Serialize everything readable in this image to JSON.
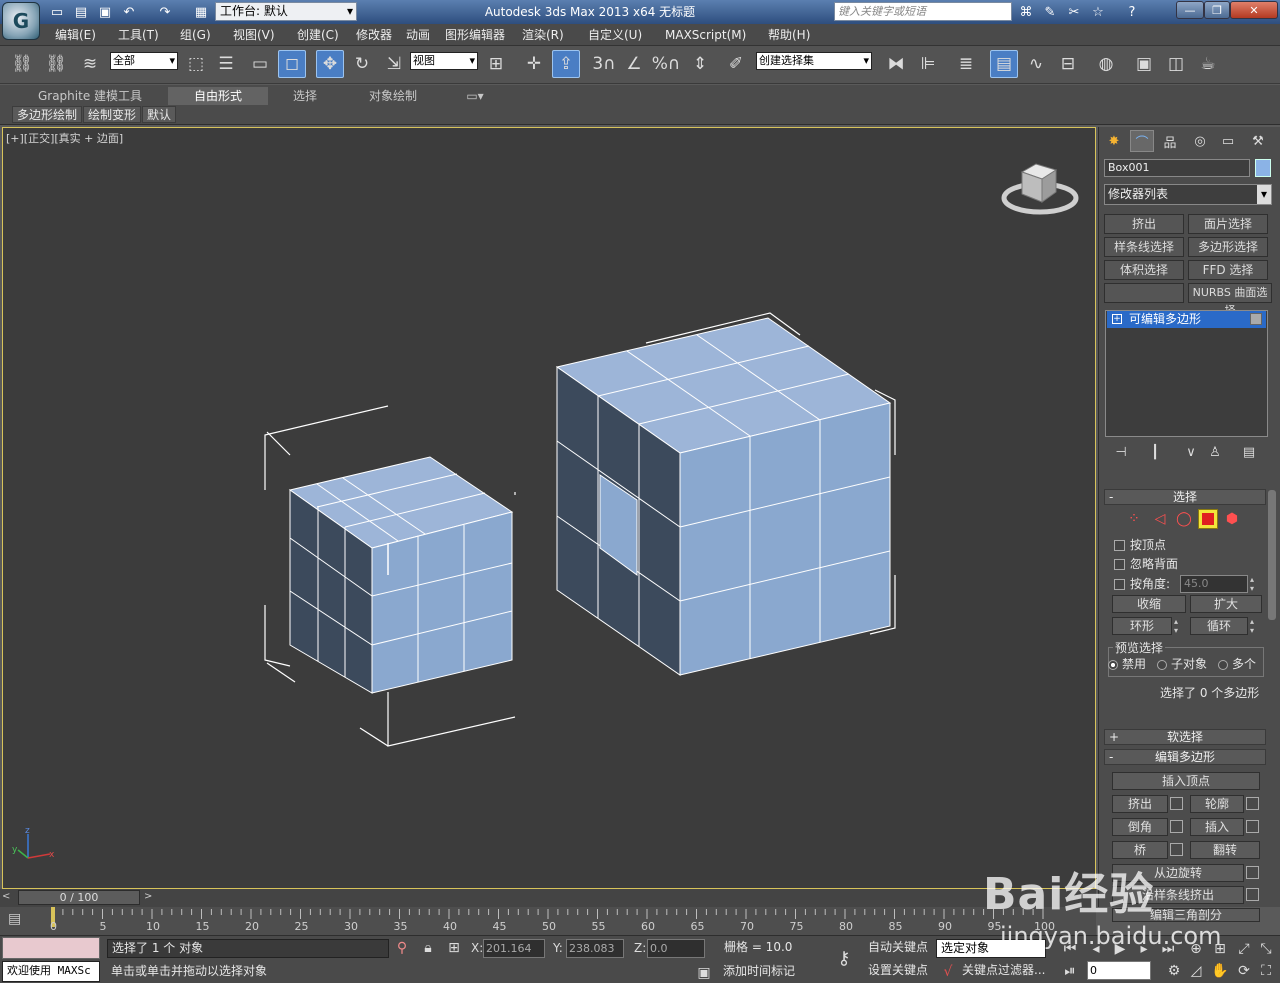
{
  "titlebar": {
    "workspace": "工作台: 默认",
    "title": "Autodesk 3ds Max  2013 x64      无标题",
    "search_placeholder": "键入关键字或短语",
    "icons": [
      "new-icon",
      "open-icon",
      "save-icon",
      "undo-icon",
      "redo-icon",
      "project-icon"
    ],
    "right_icons": [
      "binoculars-icon",
      "wrench-icon",
      "tools-icon",
      "star-icon",
      "help-icon"
    ],
    "window_buttons": [
      "minimize",
      "restore",
      "close"
    ]
  },
  "menu": {
    "items": [
      "编辑(E)",
      "工具(T)",
      "组(G)",
      "视图(V)",
      "创建(C)",
      "修改器",
      "动画",
      "图形编辑器",
      "渲染(R)",
      "自定义(U)",
      "MAXScript(M)",
      "帮助(H)"
    ]
  },
  "toolbar": {
    "selection_filter": "全部",
    "ref_coord": "视图",
    "named_sel": "创建选择集",
    "snap_labels": [
      "3",
      "%"
    ]
  },
  "ribbon": {
    "tabs": [
      "Graphite 建模工具",
      "自由形式",
      "选择",
      "对象绘制"
    ],
    "active_tab": 1,
    "subtabs": [
      "多边形绘制",
      "绘制变形",
      "默认"
    ]
  },
  "viewport": {
    "label": "[+][正交][真实 + 边面]",
    "axis_labels": {
      "z": "z",
      "y": "y",
      "x": "x"
    },
    "mesh_color": "#8da9cc",
    "border_color": "#d7c35a"
  },
  "cmdpanel": {
    "tabs": [
      "create-icon",
      "modify-icon",
      "hierarchy-icon",
      "motion-icon",
      "display-icon",
      "utilities-icon"
    ],
    "object_name": "Box001",
    "object_color": "#8bb3e6",
    "modifier_list": "修改器列表",
    "modifier_buttons": [
      "挤出",
      "面片选择",
      "样条线选择",
      "多边形选择",
      "体积选择",
      "FFD 选择",
      "",
      "NURBS 曲面选择"
    ],
    "stack_item": "可编辑多边形",
    "selection": {
      "title": "选择",
      "by_vertex": "按顶点",
      "ignore_backfacing": "忽略背面",
      "by_angle": "按角度:",
      "angle_value": "45.0",
      "shrink": "收缩",
      "grow": "扩大",
      "ring": "环形",
      "loop": "循环",
      "preview_title": "预览选择",
      "preview_options": [
        "禁用",
        "子对象",
        "多个"
      ],
      "status": "选择了 0 个多边形"
    },
    "soft_selection": "软选择",
    "edit_poly": {
      "title": "编辑多边形",
      "insert_vertex": "插入顶点",
      "buttons": [
        "挤出",
        "轮廓",
        "倒角",
        "插入",
        "桥",
        "翻转"
      ],
      "hinge": "从边旋转",
      "extrude_spline": "沿样条线挤出",
      "edit_tri": "编辑三角剖分"
    }
  },
  "timeline": {
    "frame_display": "0 / 100",
    "ticks": [
      "0",
      "5",
      "10",
      "15",
      "20",
      "25",
      "30",
      "35",
      "40",
      "45",
      "50",
      "55",
      "60",
      "65",
      "70",
      "75",
      "80",
      "85",
      "90",
      "95",
      "100"
    ]
  },
  "status": {
    "maxscript_listener": "欢迎使用 MAXSc",
    "selection_info": "选择了 1 个 对象",
    "prompt": "单击或单击并拖动以选择对象",
    "x_label": "X:",
    "x_value": "201.164",
    "y_label": "Y:",
    "y_value": "238.083",
    "z_label": "Z:",
    "z_value": "0.0",
    "grid": "栅格 = 10.0",
    "add_time_tag": "添加时间标记",
    "auto_key": "自动关键点",
    "set_key": "设置关键点",
    "key_mode": "选定对象",
    "key_filters": "关键点过滤器...",
    "current_frame": "0"
  },
  "watermark": {
    "brand": "Bai经验",
    "url": "jingyan.baidu.com"
  }
}
